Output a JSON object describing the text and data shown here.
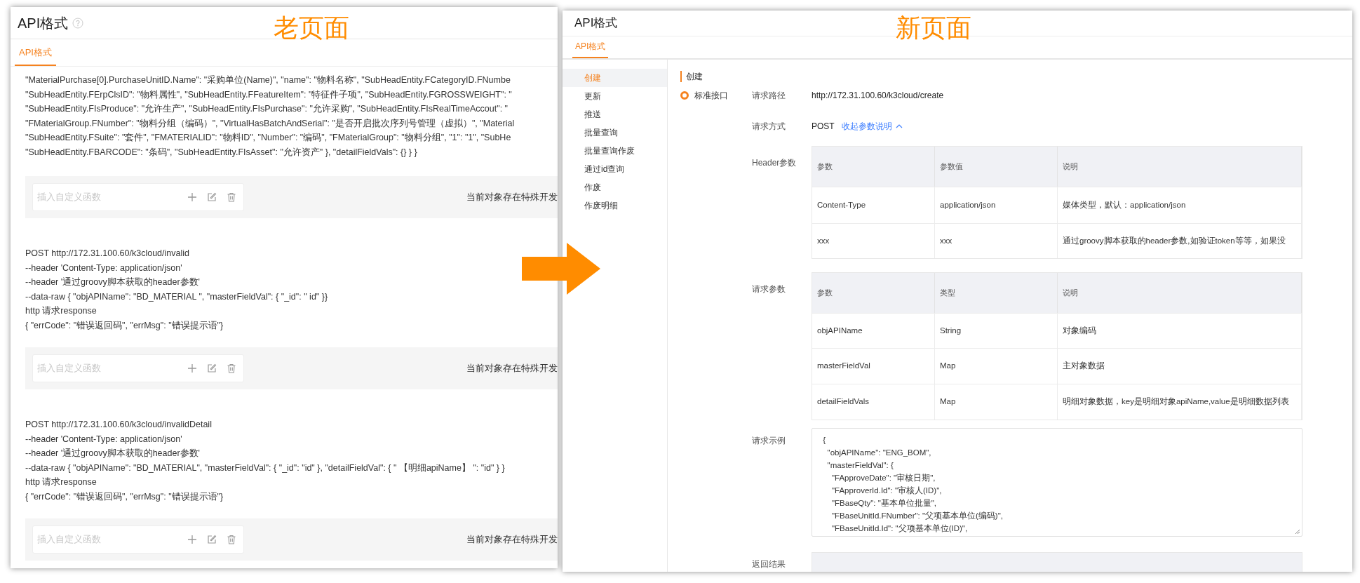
{
  "old_page": {
    "caption": "老页面",
    "title": "API格式",
    "tabs": [
      {
        "label": "API格式",
        "selected": true
      }
    ],
    "sections": [
      {
        "kind": "code",
        "lines": [
          "\"MaterialPurchase[0].PurchaseUnitID.Name\": \"采购单位(Name)\", \"name\": \"物料名称\", \"SubHeadEntity.FCategoryID.FNumbe",
          "\"SubHeadEntity.FErpClsID\": \"物料属性\", \"SubHeadEntity.FFeatureItem\": \"特征件子项\", \"SubHeadEntity.FGROSSWEIGHT\": \"",
          "\"SubHeadEntity.FIsProduce\": \"允许生产\", \"SubHeadEntity.FIsPurchase\": \"允许采购\", \"SubHeadEntity.FIsRealTimeAccout\": \"",
          "\"FMaterialGroup.FNumber\": \"物料分组（编码）\", \"VirtualHasBatchAndSerial\": \"是否开启批次序列号管理（虚拟）\", \"Material",
          "\"SubHeadEntity.FSuite\": \"套件\", \"FMATERIALID\": \"物料ID\", \"Number\": \"编码\", \"FMaterialGroup\": \"物料分组\", \"1\": \"1\", \"SubHe",
          "\"SubHeadEntity.FBARCODE\": \"条码\", \"SubHeadEntity.FIsAsset\": \"允许资产\" }, \"detailFieldVals\": {} } }"
        ]
      },
      {
        "kind": "function_bar",
        "placeholder": "插入自定义函数",
        "note": "当前对象存在特殊开发"
      },
      {
        "kind": "code",
        "lines": [
          "POST http://172.31.100.60/k3cloud/invalid",
          "--header 'Content-Type: application/json'",
          "--header '通过groovy脚本获取的header参数'",
          "--data-raw { \"objAPIName\": \"BD_MATERIAL \", \"masterFieldVal\": { \"_id\": \" id\" }}",
          "http 请求response",
          "{ \"errCode\": \"错误返回码\", \"errMsg\": \"错误提示语\"}"
        ]
      },
      {
        "kind": "function_bar",
        "placeholder": "插入自定义函数",
        "note": "当前对象存在特殊开发"
      },
      {
        "kind": "code",
        "lines": [
          "POST http://172.31.100.60/k3cloud/invalidDetail",
          "--header 'Content-Type: application/json'",
          "--header '通过groovy脚本获取的header参数'",
          "--data-raw { \"objAPIName\": \"BD_MATERIAL\", \"masterFieldVal\": { \"_id\": \"id\" }, \"detailFieldVal\": { \" 【明细apiName】 \": \"id\" } }",
          "http 请求response",
          "{ \"errCode\": \"错误返回码\", \"errMsg\": \"错误提示语\"}"
        ]
      },
      {
        "kind": "function_bar",
        "placeholder": "插入自定义函数",
        "note": "当前对象存在特殊开发"
      }
    ]
  },
  "new_page": {
    "caption": "新页面",
    "title": "API格式",
    "tabs": [
      {
        "label": "API格式",
        "selected": true
      }
    ],
    "sidebar": {
      "items": [
        {
          "label": "创建",
          "selected": true
        },
        {
          "label": "更新",
          "selected": false
        },
        {
          "label": "推送",
          "selected": false
        },
        {
          "label": "批量查询",
          "selected": false
        },
        {
          "label": "批量查询作废",
          "selected": false
        },
        {
          "label": "通过id查询",
          "selected": false
        },
        {
          "label": "作废",
          "selected": false
        },
        {
          "label": "作废明细",
          "selected": false
        }
      ]
    },
    "section_title": "创建",
    "interface_options": [
      {
        "label": "标准接口",
        "selected": true
      }
    ],
    "request_path": {
      "label": "请求路径",
      "value": "http://172.31.100.60/k3cloud/create"
    },
    "request_method": {
      "label": "请求方式",
      "value": "POST",
      "link": "收起参数说明"
    },
    "header_params": {
      "label": "Header参数",
      "columns": [
        "参数",
        "参数值",
        "说明"
      ],
      "rows": [
        [
          "Content-Type",
          "application/json",
          "媒体类型，默认：application/json"
        ],
        [
          "xxx",
          "xxx",
          "通过groovy脚本获取的header参数,如验证token等等，如果没"
        ]
      ]
    },
    "request_params": {
      "label": "请求参数",
      "columns": [
        "参数",
        "类型",
        "说明"
      ],
      "rows": [
        [
          "objAPIName",
          "String",
          "对象编码"
        ],
        [
          "masterFieldVal",
          "Map",
          "主对象数据"
        ],
        [
          "detailFieldVals",
          "Map",
          "明细对象数据，key是明细对象apiName,value是明细数据列表"
        ]
      ]
    },
    "request_example": {
      "label": "请求示例",
      "lines": [
        " {",
        "   \"objAPIName\": \"ENG_BOM\",",
        "   \"masterFieldVal\": {",
        "     \"FApproveDate\": \"审核日期\",",
        "     \"FApproverId.Id\": \"审核人(ID)\",",
        "     \"FBaseQty\": \"基本单位批量\",",
        "     \"FBaseUnitId.FNumber\": \"父项基本单位(编码)\",",
        "     \"FBaseUnitId.Id\": \"父项基本单位(ID)\","
      ]
    },
    "response": {
      "label": "返回结果"
    }
  }
}
